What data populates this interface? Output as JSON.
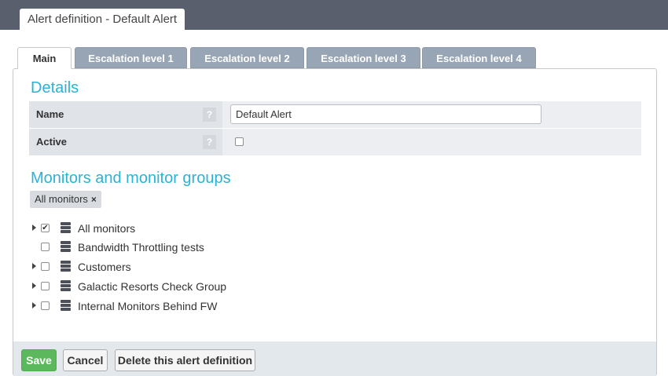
{
  "window": {
    "title": "Alert definition - Default Alert"
  },
  "tabs": [
    {
      "label": "Main"
    },
    {
      "label": "Escalation level 1"
    },
    {
      "label": "Escalation level 2"
    },
    {
      "label": "Escalation level 3"
    },
    {
      "label": "Escalation level 4"
    }
  ],
  "details": {
    "title": "Details",
    "name_label": "Name",
    "name_value": "Default Alert",
    "active_label": "Active",
    "help_glyph": "?"
  },
  "monitors": {
    "title": "Monitors and monitor groups",
    "chip_label": "All monitors",
    "chip_remove": "×",
    "items": [
      {
        "label": "All monitors",
        "checked": true,
        "expandable": true
      },
      {
        "label": "Bandwidth Throttling tests",
        "checked": false,
        "expandable": false
      },
      {
        "label": "Customers",
        "checked": false,
        "expandable": true
      },
      {
        "label": "Galactic Resorts Check Group",
        "checked": false,
        "expandable": true
      },
      {
        "label": "Internal Monitors Behind FW",
        "checked": false,
        "expandable": true
      }
    ]
  },
  "footer": {
    "save_label": "Save",
    "cancel_label": "Cancel",
    "delete_label": "Delete this alert definition"
  },
  "colors": {
    "accent": "#2ab3d6",
    "topbar": "#5a5f6e",
    "tab_inactive": "#98a5b4",
    "save_green": "#5cb85c"
  },
  "icons": {
    "tree_item": "server-stack-icon",
    "expand": "caret-right-icon",
    "help": "help-icon",
    "remove": "close-icon"
  }
}
